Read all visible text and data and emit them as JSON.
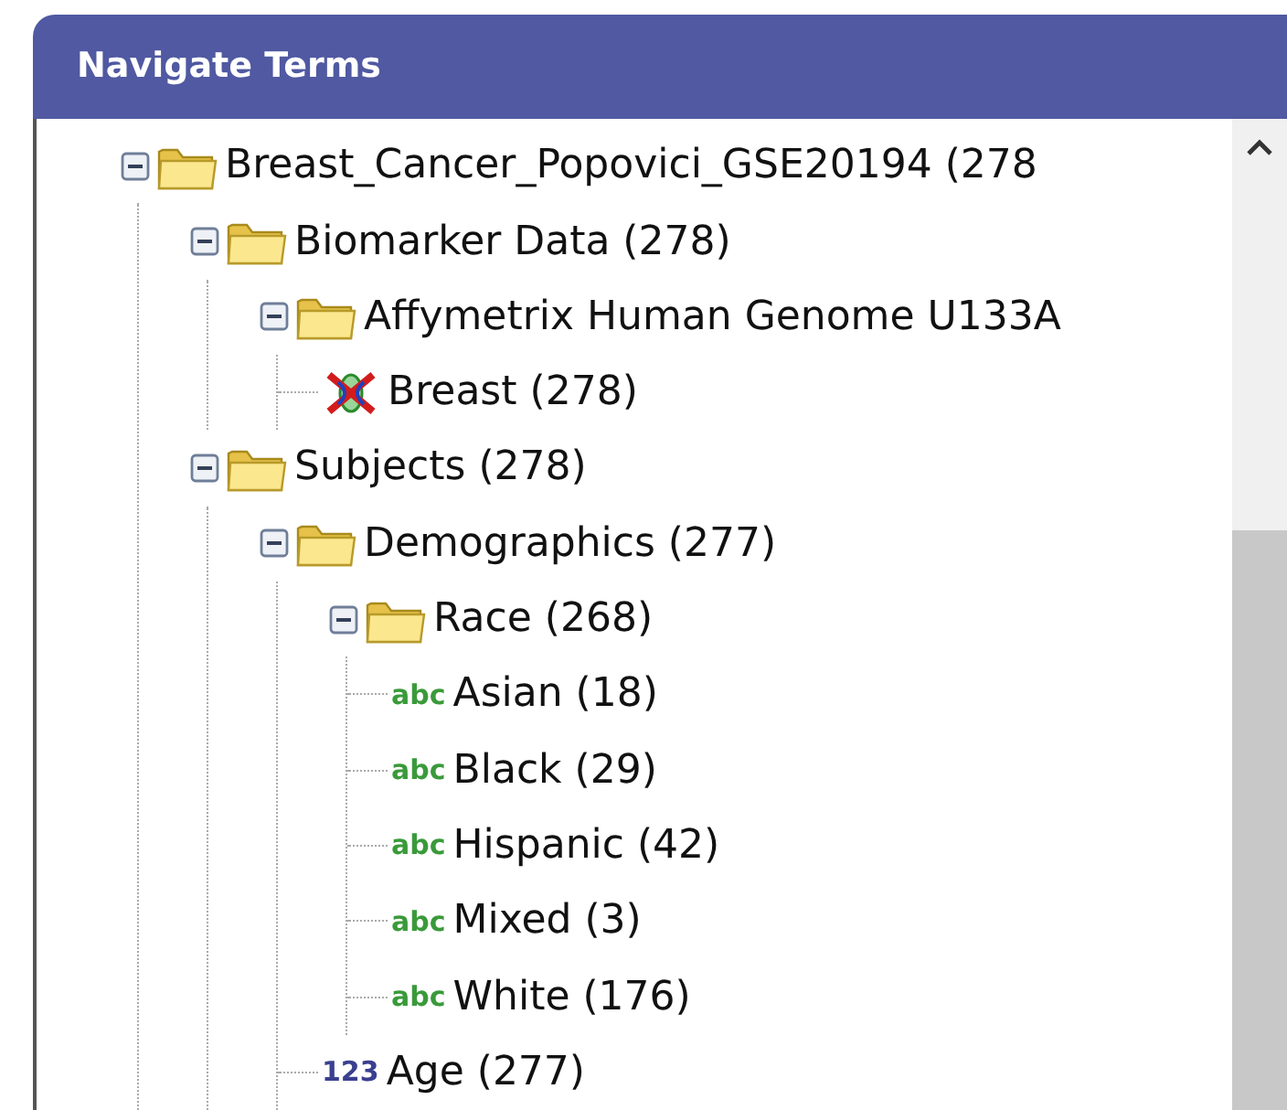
{
  "panel": {
    "title": "Navigate Terms"
  },
  "tree": [
    {
      "kind": "folder",
      "label": "Breast_Cancer_Popovici_GSE20194 (278",
      "expanded": true,
      "children": [
        {
          "kind": "folder",
          "label": "Biomarker Data (278)",
          "expanded": true,
          "children": [
            {
              "kind": "folder",
              "label": "Affymetrix Human Genome U133A",
              "expanded": true,
              "children": [
                {
                  "kind": "genes",
                  "label": "Breast (278)"
                }
              ]
            }
          ]
        },
        {
          "kind": "folder",
          "label": "Subjects (278)",
          "expanded": true,
          "children": [
            {
              "kind": "folder",
              "label": "Demographics (277)",
              "expanded": true,
              "children": [
                {
                  "kind": "folder",
                  "label": "Race (268)",
                  "expanded": true,
                  "children": [
                    {
                      "kind": "text",
                      "badge": "abc",
                      "label": "Asian (18)"
                    },
                    {
                      "kind": "text",
                      "badge": "abc",
                      "label": "Black (29)"
                    },
                    {
                      "kind": "text",
                      "badge": "abc",
                      "label": "Hispanic (42)"
                    },
                    {
                      "kind": "text",
                      "badge": "abc",
                      "label": "Mixed (3)"
                    },
                    {
                      "kind": "text",
                      "badge": "abc",
                      "label": "White (176)"
                    }
                  ]
                },
                {
                  "kind": "number",
                  "badge": "123",
                  "label": "Age (277)"
                }
              ]
            }
          ]
        }
      ]
    }
  ]
}
